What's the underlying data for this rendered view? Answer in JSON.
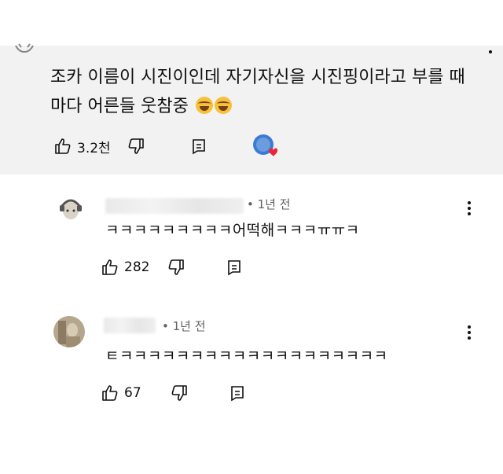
{
  "main_comment": {
    "line1": "조카 이름이 시진이인데 자기자신을 시진핑이라고 부를 때",
    "line2": "마다 어른들 웃참중",
    "emoji": "face-with-tears-of-joy",
    "likes": "3.2천"
  },
  "replies": [
    {
      "time": "• 1년 전",
      "text": "ㅋㅋㅋㅋㅋㅋㅋㅋㅋ어떡해ㅋㅋㅋㅠㅠㅋ",
      "likes": "282"
    },
    {
      "time": "• 1년 전",
      "text": "ㅌㅋㅋㅋㅋㅋㅋㅋㅋㅋㅋㅋㅋㅋㅋㅋㅋㅋㅋㅋ",
      "likes": "67"
    }
  ],
  "colors": {
    "main_bg": "#f2f2f2",
    "text": "#0f0f0f",
    "meta": "#606060",
    "heart": "#e8283b",
    "creator_badge": "#3a7bd5"
  }
}
